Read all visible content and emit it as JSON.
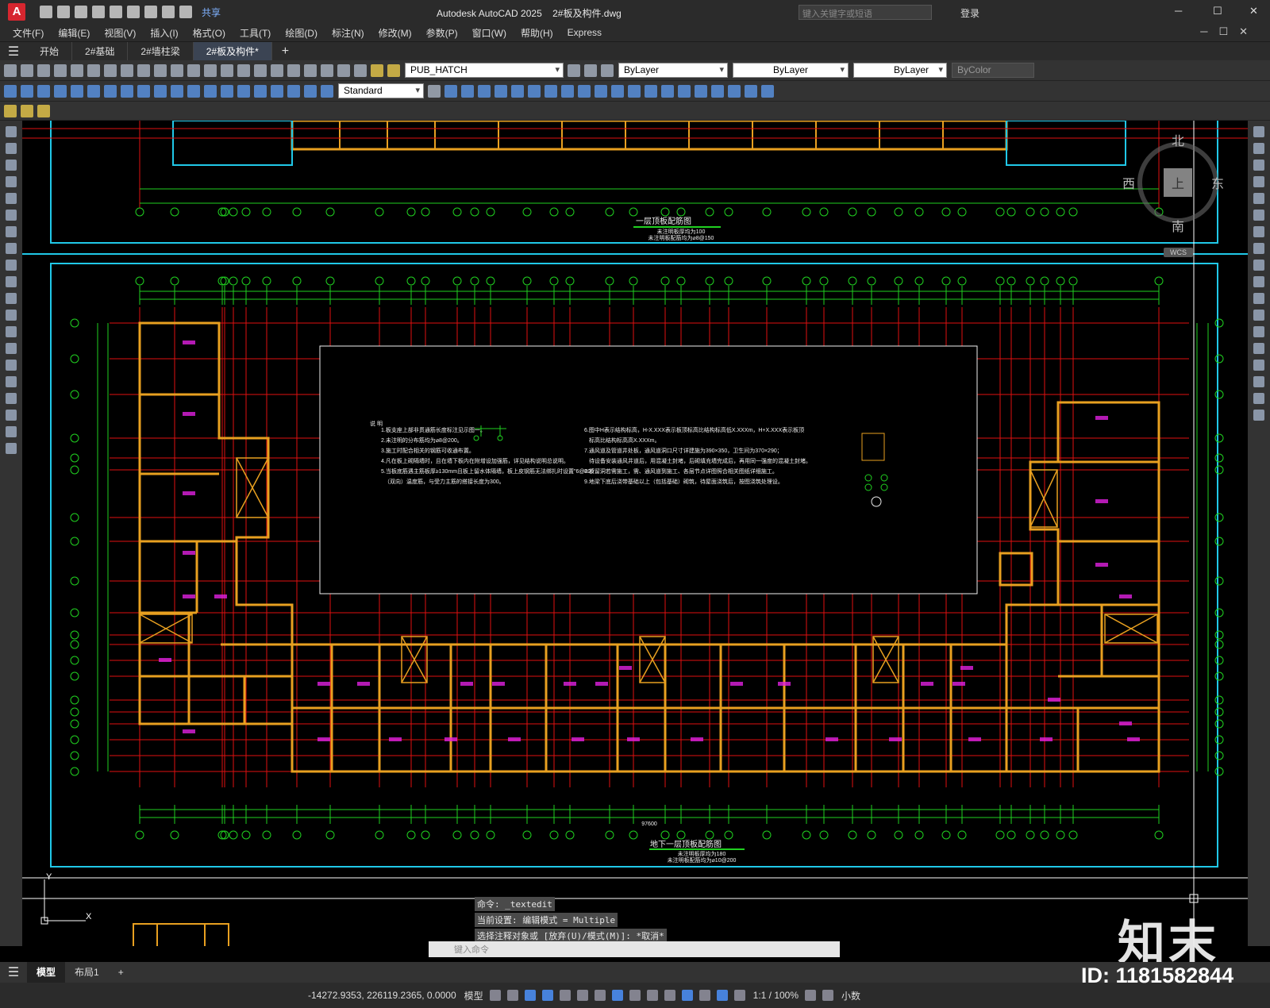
{
  "app": {
    "logo": "A",
    "title": "Autodesk AutoCAD 2025",
    "document": "2#板及构件.dwg",
    "share": "共享",
    "search_placeholder": "键入关键字或短语",
    "login": "登录"
  },
  "menu": [
    "文件(F)",
    "编辑(E)",
    "视图(V)",
    "插入(I)",
    "格式(O)",
    "工具(T)",
    "绘图(D)",
    "标注(N)",
    "修改(M)",
    "参数(P)",
    "窗口(W)",
    "帮助(H)",
    "Express"
  ],
  "doc_tabs": [
    {
      "label": "开始",
      "active": false
    },
    {
      "label": "2#基础",
      "active": false
    },
    {
      "label": "2#墙柱梁",
      "active": false
    },
    {
      "label": "2#板及构件*",
      "active": true
    }
  ],
  "toolbar": {
    "layer": "PUB_HATCH",
    "color": "ByLayer",
    "linetype": "ByLayer",
    "lineweight": "ByLayer",
    "plotstyle": "ByColor",
    "textstyle": "Standard"
  },
  "viewcube": {
    "north": "北",
    "south": "南",
    "east": "东",
    "west": "西",
    "top": "上",
    "wcs": "WCS"
  },
  "drawing": {
    "upper_title": "一层顶板配筋图",
    "upper_note1": "未注明板厚均为100",
    "upper_note2": "未注明板配筋均为⌀8@150",
    "lower_title": "地下一层顶板配筋图",
    "lower_note1": "未注明板厚均为180",
    "lower_note2": "未注明板配筋均为⌀10@200",
    "total_dim": "97600",
    "notes_heading": "说 明",
    "notes_left": [
      "1.板支座上部非贯通筋长度标注见示图一。",
      "2.未注明的分布筋均为⌀8@200。",
      "3.施工时配合相关的钢筋可收通布置。",
      "4.凡在板上砌隔墙时，且在墙下板内在附增设加强筋，详见结构说明总说明。",
      "5.当板底筋遇主筋板厚≥130mm且板上留水体隔墙，板上皮钢筋无法绑扎时设置\"6@200",
      "（双向）温度筋，与受力主筋的搭接长度为300。"
    ],
    "notes_right": [
      "6.图中H表示结构标高，H-X.XXX表示板顶标高比结构标高低X.XXXm，H+X.XXX表示板顶",
      "标高比结构标高高X.XXXm。",
      "7.通风道及管道井处板，通风道洞口尺寸详建施为390×350，卫生间为370×290；",
      "待设备安装通风井道后，用混凝土封堵，后砌填充墙完成后，再用同一强度的混凝土封堵。",
      "8.板留洞若需施工，需、通风道到施工、各层节点详图照合相关图纸详细施工。",
      "9.地梁下底后浇带基础以上（包括基础）砌筑，待屋面浇筑后，按图浇筑处理设。"
    ]
  },
  "command": {
    "line1": "命令: _textedit",
    "line2": "当前设置: 编辑模式 = Multiple",
    "line3": "选择注释对象或 [放弃(U)/模式(M)]: *取消*",
    "placeholder": "键入命令"
  },
  "layout_tabs": [
    {
      "label": "模型",
      "active": true
    },
    {
      "label": "布局1",
      "active": false
    }
  ],
  "status": {
    "coords": "-14272.9353, 226119.2365, 0.0000",
    "mode": "模型",
    "scale": "1:1 / 100%",
    "units": "小数"
  },
  "watermark": {
    "brand": "知末",
    "id": "ID: 1181582844"
  },
  "colors": {
    "wall": "#e8a020",
    "axis_red": "#e01010",
    "dim_green": "#20d020",
    "frame_cyan": "#20c8e8",
    "label_magenta": "#e020e0",
    "bg": "#000000"
  }
}
